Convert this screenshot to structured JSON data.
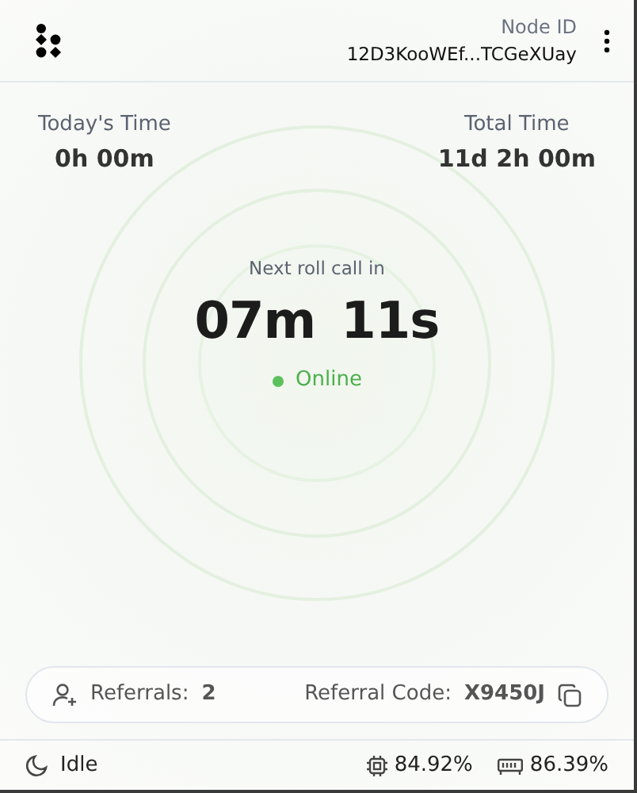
{
  "header": {
    "node_id_label": "Node ID",
    "node_id": "12D3KooWEf...TCGeXUay"
  },
  "stats": [
    {
      "label": "Today's Time",
      "value": "0h 00m"
    },
    {
      "label": "Total Time",
      "value": "11d 2h 00m"
    }
  ],
  "countdown": {
    "label": "Next roll call in",
    "minutes": "07m",
    "seconds": "11s"
  },
  "status": {
    "label": "Online",
    "online": true
  },
  "referral": {
    "referrals_label": "Referrals:",
    "referrals": "2",
    "code_label": "Referral Code:",
    "code": "X9450J"
  },
  "footer": {
    "state": "Idle",
    "cpu": "84.92%",
    "memory": "86.39%"
  }
}
